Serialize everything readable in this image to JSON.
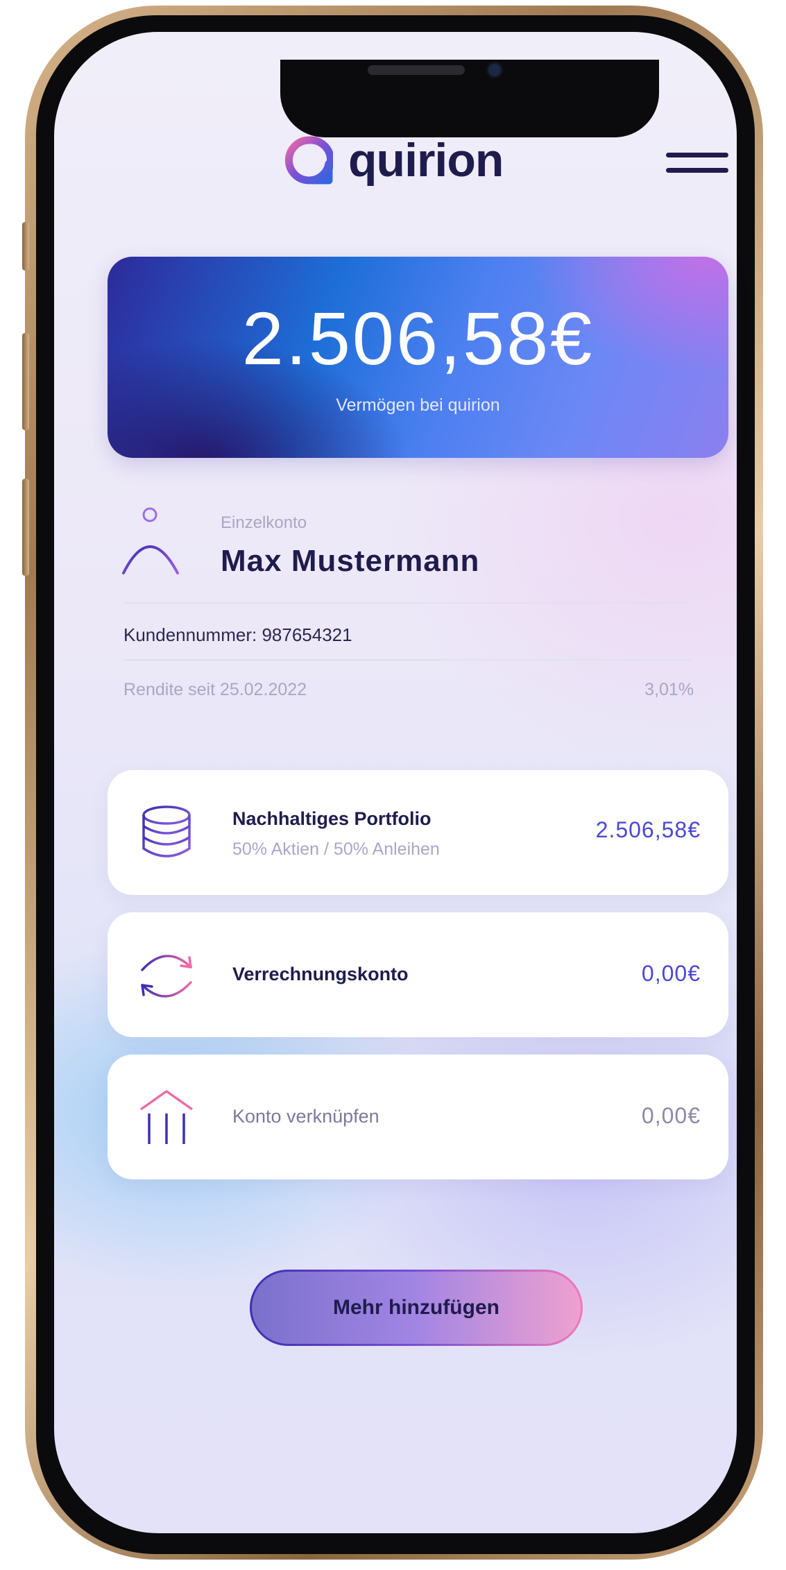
{
  "header": {
    "logo_text": "quirion",
    "menu_icon": "hamburger-menu-icon"
  },
  "balance": {
    "amount": "2.506,58€",
    "label": "Vermögen bei quirion"
  },
  "account": {
    "type": "Einzelkonto",
    "name": "Max Mustermann",
    "customer_number": "Kundennummer: 987654321",
    "return_label": "Rendite seit 25.02.2022",
    "return_value": "3,01%"
  },
  "rows": [
    {
      "icon": "coin-stack-icon",
      "title": "Nachhaltiges Portfolio",
      "subtitle": "50% Aktien / 50% Anleihen",
      "value": "2.506,58€"
    },
    {
      "icon": "refresh-arrows-icon",
      "title": "Verrechnungskonto",
      "value": "0,00€"
    },
    {
      "icon": "bank-building-icon",
      "title": "Konto verknüpfen",
      "value": "0,00€"
    }
  ],
  "actions": {
    "add_more_label": "Mehr hinzufügen"
  },
  "colors": {
    "brand_dark": "#1f1c4d",
    "accent_blue": "#4b47d6",
    "accent_pink": "#f17ab8"
  }
}
